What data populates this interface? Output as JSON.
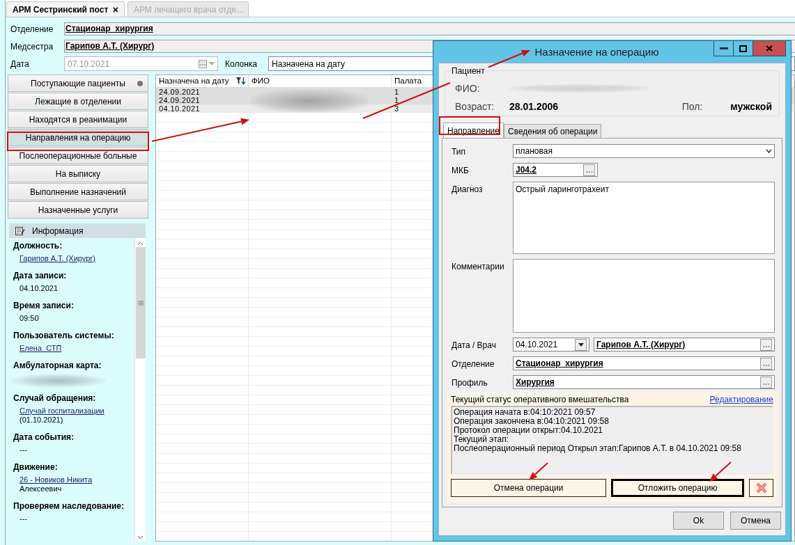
{
  "tabs": [
    {
      "label": "АРМ Сестринский пост",
      "selected": true,
      "close": "×"
    },
    {
      "label": "АРМ лечащего врача отде…",
      "selected": false
    }
  ],
  "filters": {
    "department": {
      "label": "Отделение",
      "value": "Стационар  хирургия"
    },
    "nurse": {
      "label": "Медсестра",
      "value": "Гарипов А.Т. (Хирург)"
    },
    "date": {
      "label": "Дата",
      "value": "07.10.2021",
      "disabled": true
    },
    "column": {
      "label": "Колонка",
      "value": "Назначена на дату"
    }
  },
  "nav": [
    {
      "label": "Поступающие пациенты",
      "selected": false,
      "indicator": true
    },
    {
      "label": "Лежащие в отделении",
      "selected": false,
      "indicator": false
    },
    {
      "label": "Находятся в реанимации",
      "selected": false,
      "indicator": false
    },
    {
      "label": "Направления на операцию",
      "selected": true,
      "indicator": false
    },
    {
      "label": "Послеоперационные больные",
      "selected": false,
      "indicator": false
    },
    {
      "label": "На выписку",
      "selected": false,
      "indicator": false
    },
    {
      "label": "Выполнение назначений",
      "selected": false,
      "indicator": false
    },
    {
      "label": "Назначенные услуги",
      "selected": false,
      "indicator": false
    }
  ],
  "info_panel": {
    "title": "Информация",
    "fields": [
      {
        "label": "Должность:",
        "kind": "link",
        "value": "Гарипов А.Т. (Хирург)"
      },
      {
        "label": "Дата записи:",
        "kind": "text",
        "value": "04.10.2021"
      },
      {
        "label": "Время записи:",
        "kind": "text",
        "value": "09:50"
      },
      {
        "label": "Пользователь системы:",
        "kind": "link",
        "value": "Елена  СТП"
      },
      {
        "label": "Амбулаторная карта:",
        "kind": "redacted"
      },
      {
        "label": "Случай обращения:",
        "kind": "link",
        "value": "Случай госпитализации",
        "note": "(01.10.2021)"
      },
      {
        "label": "Дата события:",
        "kind": "text",
        "value": "---"
      },
      {
        "label": "Движение:",
        "kind": "link",
        "value": "26 - Новиков Никита",
        "note": "Алексеевич"
      },
      {
        "label": "Проверяем наследование:",
        "kind": "text",
        "value": "---"
      }
    ]
  },
  "table": {
    "columns": [
      "Назначена на дату",
      "ФИО",
      "Палата"
    ],
    "rows": [
      {
        "date": "24.09.2021",
        "ward": "1",
        "highlighted": true
      },
      {
        "date": "24.09.2021",
        "ward": "1",
        "highlighted": true
      },
      {
        "date": "04.10.2021",
        "ward": "3",
        "highlighted": false
      }
    ]
  },
  "dialog": {
    "title": "Назначение на операцию",
    "patient": {
      "group": "Пациент",
      "fio_label": "ФИО:",
      "age_label": "Возраст:",
      "age": "28.01.2006",
      "sex_label": "Пол:",
      "sex": "мужской"
    },
    "tabs": [
      {
        "label": "Направление",
        "selected": true
      },
      {
        "label": "Сведения об операции",
        "selected": false
      }
    ],
    "form": {
      "type": {
        "label": "Тип",
        "value": "плановая"
      },
      "mkb": {
        "label": "МКБ",
        "value": "J04.2"
      },
      "diagnosis": {
        "label": "Диагноз",
        "value": "Острый ларинготрахеит"
      },
      "comments": {
        "label": "Комментарии"
      },
      "date_doctor": {
        "label": "Дата / Врач",
        "date": "04.10.2021",
        "doctor": "Гарипов А.Т. (Хирург)"
      },
      "department": {
        "label": "Отделение",
        "value": "Стационар  хирургия"
      },
      "profile": {
        "label": "Профиль",
        "value": "Хирургия"
      }
    },
    "status": {
      "title": "Текущий статус оперативного вмешательства",
      "edit_link": "Редактирование",
      "lines": [
        "Операция начата в:04:10:2021 09:57",
        "Операция закончена в:04:10:2021 09:58",
        "Протокол операции открыт:04.10.2021",
        "Текущий этап:",
        "Послеоперационный период Открыл этап:Гарипов А.Т. в 04.10.2021 09:58"
      ],
      "actions": [
        {
          "label": "Отмена операции",
          "focused": false
        },
        {
          "label": "Отложить операцию",
          "focused": true
        }
      ]
    },
    "buttons": [
      "Ok",
      "Отмена"
    ]
  }
}
